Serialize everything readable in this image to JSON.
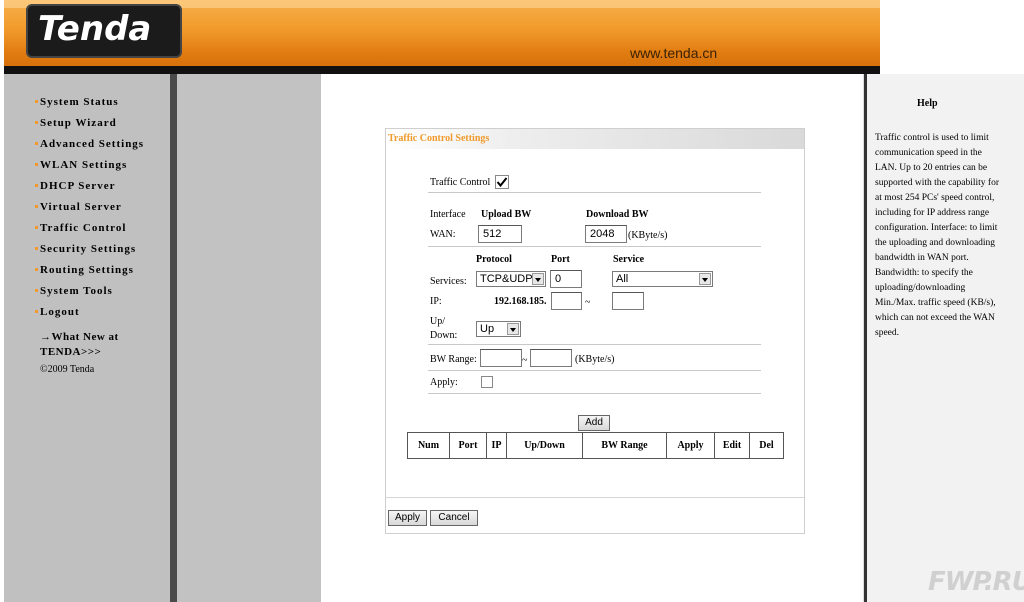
{
  "header": {
    "logo_text": "Tenda",
    "site_url": "www.tenda.cn"
  },
  "nav": {
    "items": [
      {
        "label": "System Status"
      },
      {
        "label": "Setup Wizard"
      },
      {
        "label": "Advanced Settings"
      },
      {
        "label": "WLAN Settings"
      },
      {
        "label": "DHCP Server"
      },
      {
        "label": "Virtual Server"
      },
      {
        "label": "Traffic Control"
      },
      {
        "label": "Security Settings"
      },
      {
        "label": "Routing Settings"
      },
      {
        "label": "System Tools"
      },
      {
        "label": "Logout"
      }
    ],
    "whats_new": "→What New at TENDA>>>",
    "copyright": "©2009 Tenda"
  },
  "form": {
    "title": "Traffic Control Settings",
    "traffic_control_label": "Traffic Control",
    "traffic_control_checked": true,
    "interface_label": "Interface",
    "upload_bw_label": "Upload BW",
    "download_bw_label": "Download BW",
    "wan_label": "WAN:",
    "upload_bw_value": "512",
    "download_bw_value": "2048",
    "kbyte_unit": "(KByte/s)",
    "protocol_label": "Protocol",
    "port_label": "Port",
    "service_label": "Service",
    "services_label": "Services:",
    "protocol_value": "TCP&UDP",
    "port_value": "0",
    "service_value": "All",
    "ip_label": "IP:",
    "ip_prefix": "192.168.185.",
    "ip_separator": "~",
    "updown_label": "Up/ Down:",
    "updown_value": "Up",
    "bw_range_label": "BW Range:",
    "bw_range_separator": "~",
    "bw_range_unit": "(KByte/s)",
    "apply_label": "Apply:",
    "apply_checked": false,
    "add_button": "Add",
    "table_headers": [
      "Num",
      "Port",
      "IP",
      "Up/Down",
      "BW Range",
      "Apply",
      "Edit",
      "Del"
    ],
    "apply_button": "Apply",
    "cancel_button": "Cancel"
  },
  "help": {
    "title": "Help",
    "text": "Traffic control is used to limit communication speed in the LAN. Up to 20 entries can be supported with the capability for at most 254 PCs' speed control, including for IP address range configuration. Interface: to limit the uploading and downloading bandwidth in WAN port. Bandwidth: to specify the uploading/downloading Min./Max. traffic speed (KB/s), which can not exceed the WAN speed."
  },
  "watermark": "FWP.RU",
  "colors": {
    "accent_orange": "#f19a2b",
    "nav_bg": "#c0c0c0",
    "help_bg": "#f2f2f2"
  }
}
